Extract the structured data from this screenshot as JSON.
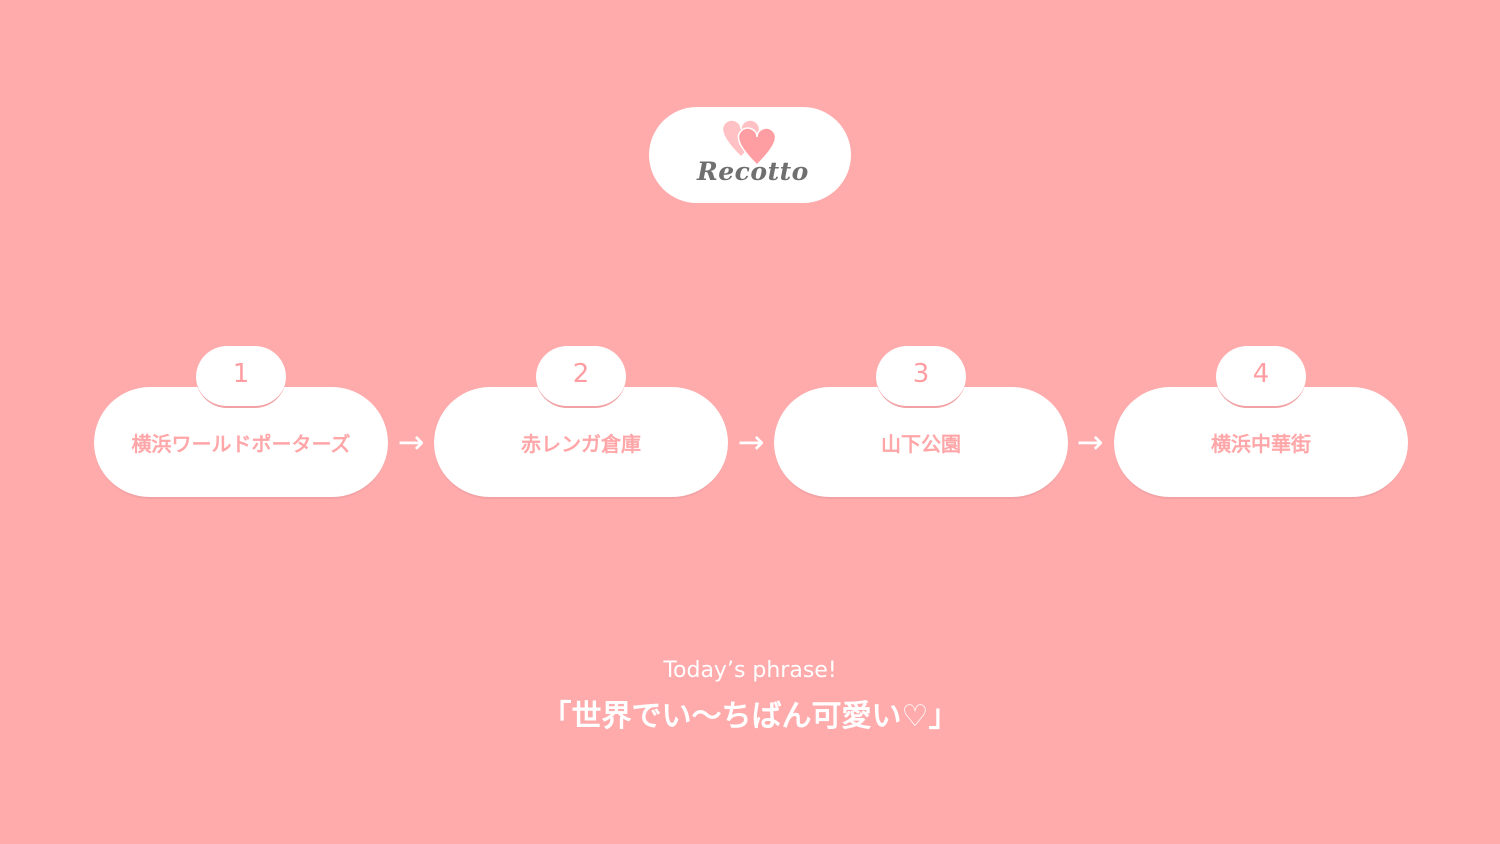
{
  "brand": {
    "name": "Recotto",
    "logo_icon": "double-heart-icon",
    "heart_colors": [
      "#ffb3b6",
      "#ff9ea2"
    ]
  },
  "route": {
    "steps": [
      {
        "number": "1",
        "name": "横浜ワールドポーターズ"
      },
      {
        "number": "2",
        "name": "赤レンガ倉庫"
      },
      {
        "number": "3",
        "name": "山下公園"
      },
      {
        "number": "4",
        "name": "横浜中華街"
      }
    ],
    "arrow_glyph": "→"
  },
  "phrase": {
    "label": "Today’s phrase!",
    "text": "「世界でい〜ちばん可愛い♡」"
  },
  "colors": {
    "background": "#ffaaab",
    "card": "#ffffff",
    "accent_text": "#ffa6a8"
  }
}
